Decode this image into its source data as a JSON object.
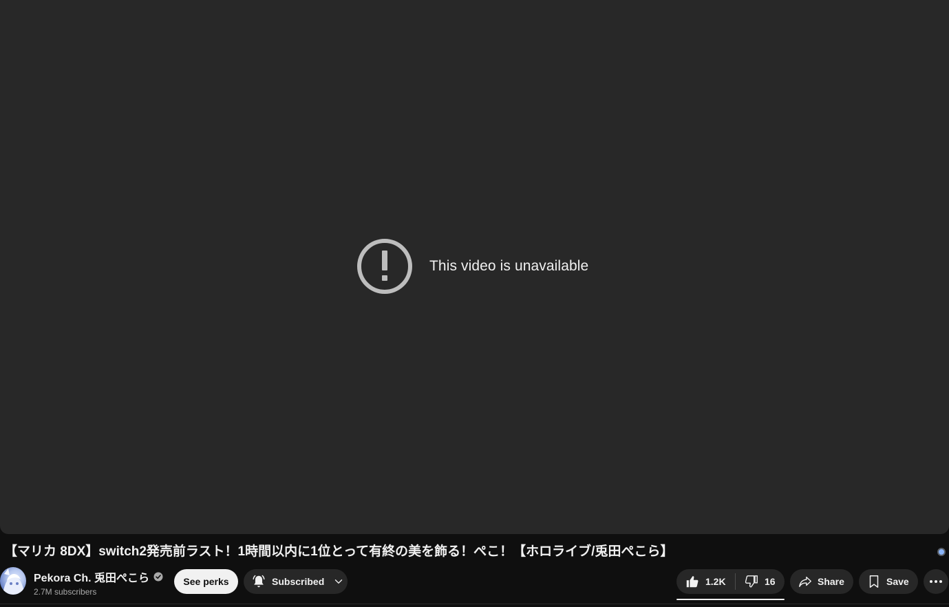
{
  "player": {
    "message": "This video is unavailable"
  },
  "video": {
    "title": "【マリカ 8DX】switch2発売前ラスト！1時間以内に1位とって有終の美を飾る！ぺこ！【ホロライブ/兎田ぺこら】"
  },
  "channel": {
    "name": "Pekora Ch. 兎田ぺこら",
    "subscribers": "2.7M subscribers",
    "verified_icon": "verified-check-icon"
  },
  "actions": {
    "see_perks": "See perks",
    "subscribed": "Subscribed",
    "likes": "1.2K",
    "dislikes": "16",
    "share": "Share",
    "save": "Save"
  },
  "colors": {
    "player_bg": "#282828",
    "page_bg": "#0f0f0f",
    "button_bg": "#272727",
    "primary_button_bg": "#f1f1f1"
  }
}
